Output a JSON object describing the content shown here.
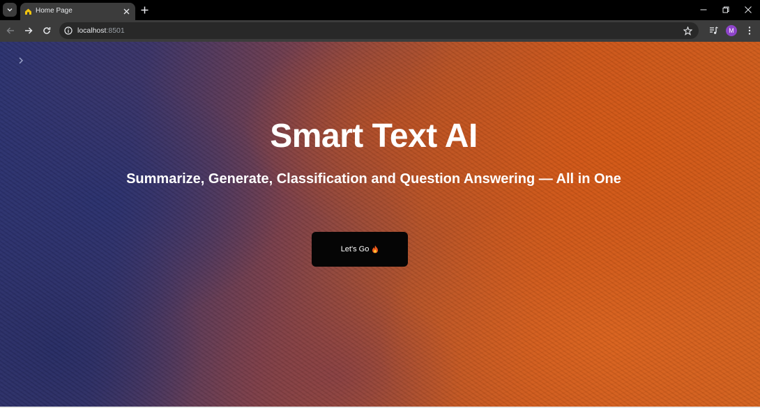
{
  "browser": {
    "tab": {
      "title": "Home Page",
      "favicon": "home-icon"
    },
    "url": {
      "host": "localhost",
      "port": ":8501"
    },
    "avatar_initial": "M",
    "icons": {
      "tab_search": "chevron-down-icon",
      "tab_close": "close-icon",
      "new_tab": "plus-icon",
      "back": "arrow-left-icon",
      "forward": "arrow-right-icon",
      "reload": "reload-icon",
      "site_info": "info-icon",
      "bookmark": "star-icon",
      "media": "media-control-icon",
      "menu": "kebab-menu-icon"
    }
  },
  "page": {
    "title": "Smart Text AI",
    "subtitle": "Summarize, Generate, Classification and Question Answering — All in One",
    "cta_label": "Let's Go",
    "cta_icon": "fire-icon",
    "sidebar_toggle_icon": "chevron-right-icon"
  },
  "colors": {
    "tabstrip": "#000000",
    "toolbar": "#3c3c3c",
    "omnibox": "#282828",
    "avatar": "#8e44c9",
    "cta_background": "#050505",
    "background_blue": "#2c3370",
    "background_orange": "#d0601e"
  }
}
